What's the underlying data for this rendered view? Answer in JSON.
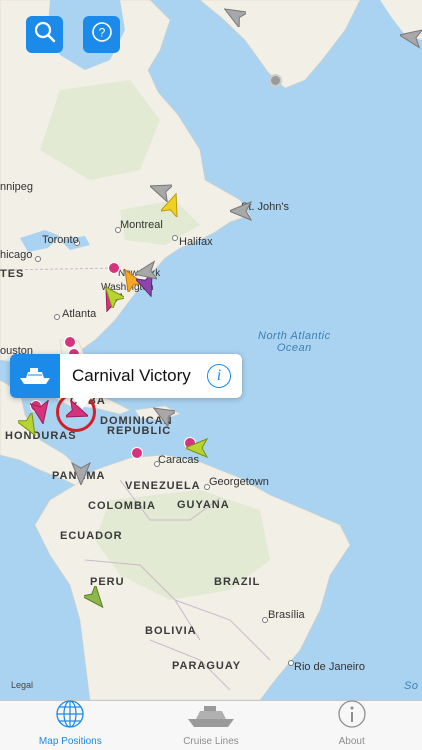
{
  "toolbar": {
    "search_icon": "search-icon",
    "help_icon": "question-circle-icon"
  },
  "map": {
    "countries": [
      "TES",
      "HONDURAS",
      "DOMINICAN",
      "REPUBLIC",
      "PANAMA",
      "VENEZUELA",
      "GUYANA",
      "COLOMBIA",
      "ECUADOR",
      "PERU",
      "BRAZIL",
      "BOLIVIA",
      "PARAGUAY",
      "CUBA"
    ],
    "cities": [
      "nnipeg",
      "Montreal",
      "St. John's",
      "Toronto",
      "Halifax",
      "hicago",
      "New York",
      "Washington",
      "Atlanta",
      "ouston",
      "Caracas",
      "Georgetown",
      "Brasília",
      "Rio de Janeiro"
    ],
    "ocean": [
      "North Atlantic",
      "Ocean"
    ],
    "edge_text": "So",
    "legal": "Legal"
  },
  "callout": {
    "ship_name": "Carnival Victory",
    "info_glyph": "i"
  },
  "tabs": [
    {
      "label": "Map Positions",
      "icon": "globe-icon",
      "active": true
    },
    {
      "label": "Cruise Lines",
      "icon": "cruise-ship-icon",
      "active": false
    },
    {
      "label": "About",
      "icon": "info-circle-icon",
      "active": false
    }
  ],
  "colors": {
    "accent": "#1b8ae8",
    "ocean": "#a9d3f1",
    "land": "#f2efe6",
    "port": "#d6337d"
  }
}
